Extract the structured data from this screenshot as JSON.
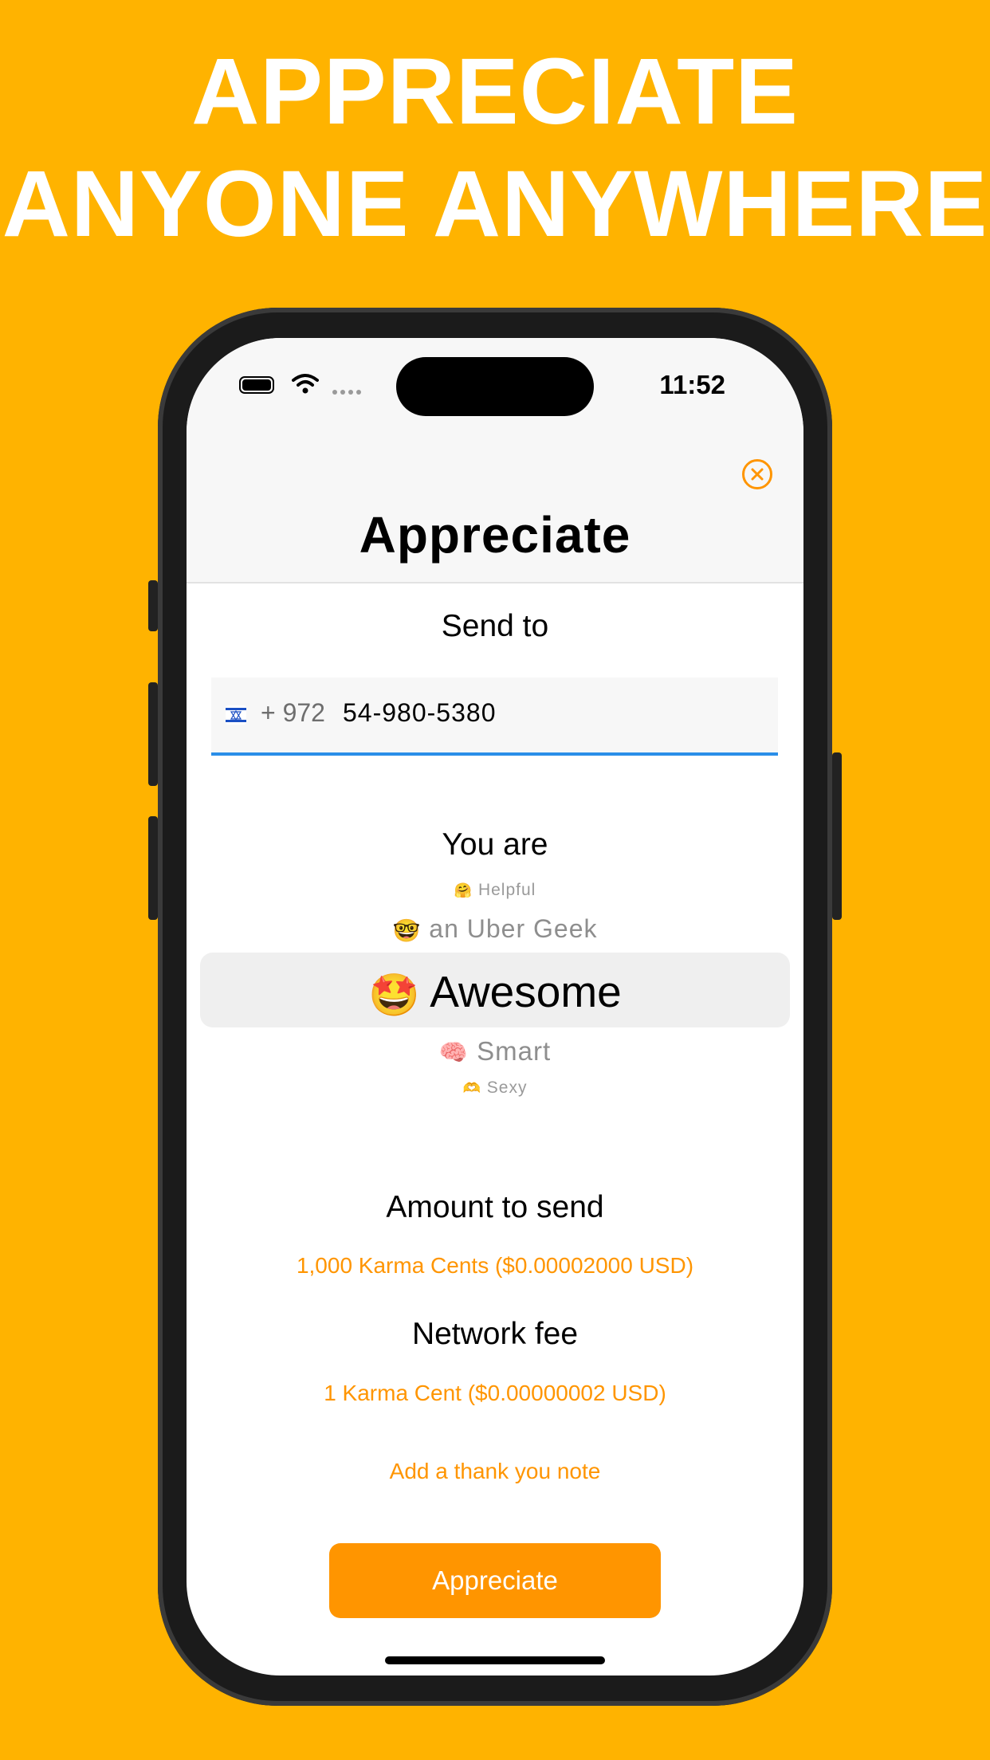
{
  "headline": {
    "line1": "APPRECIATE",
    "line2": "ANYONE ANYWHERE"
  },
  "status_bar": {
    "time": "11:52"
  },
  "nav": {
    "title": "Appreciate",
    "close_icon": "close-circle-icon"
  },
  "send_to": {
    "label": "Send to",
    "country_code": "+ 972",
    "phone_number": "54-980-5380",
    "flag_icon": "israel-flag-icon"
  },
  "picker": {
    "label": "You are",
    "items": [
      {
        "emoji": "🤗",
        "text": "Helpful"
      },
      {
        "emoji": "🤓",
        "text": "an Uber Geek"
      },
      {
        "emoji": "🤩",
        "text": "Awesome"
      },
      {
        "emoji": "🧠",
        "text": "Smart"
      },
      {
        "emoji": "🫶",
        "text": "Sexy"
      }
    ],
    "selected_index": 2
  },
  "amount": {
    "label": "Amount to send",
    "value": "1,000 Karma Cents ($0.00002000 USD)"
  },
  "fee": {
    "label": "Network fee",
    "value": "1 Karma Cent ($0.00000002 USD)"
  },
  "note_link": "Add a thank you note",
  "cta_label": "Appreciate",
  "colors": {
    "background": "#FFB300",
    "accent": "#FF9500",
    "input_underline": "#2A8EE8"
  }
}
